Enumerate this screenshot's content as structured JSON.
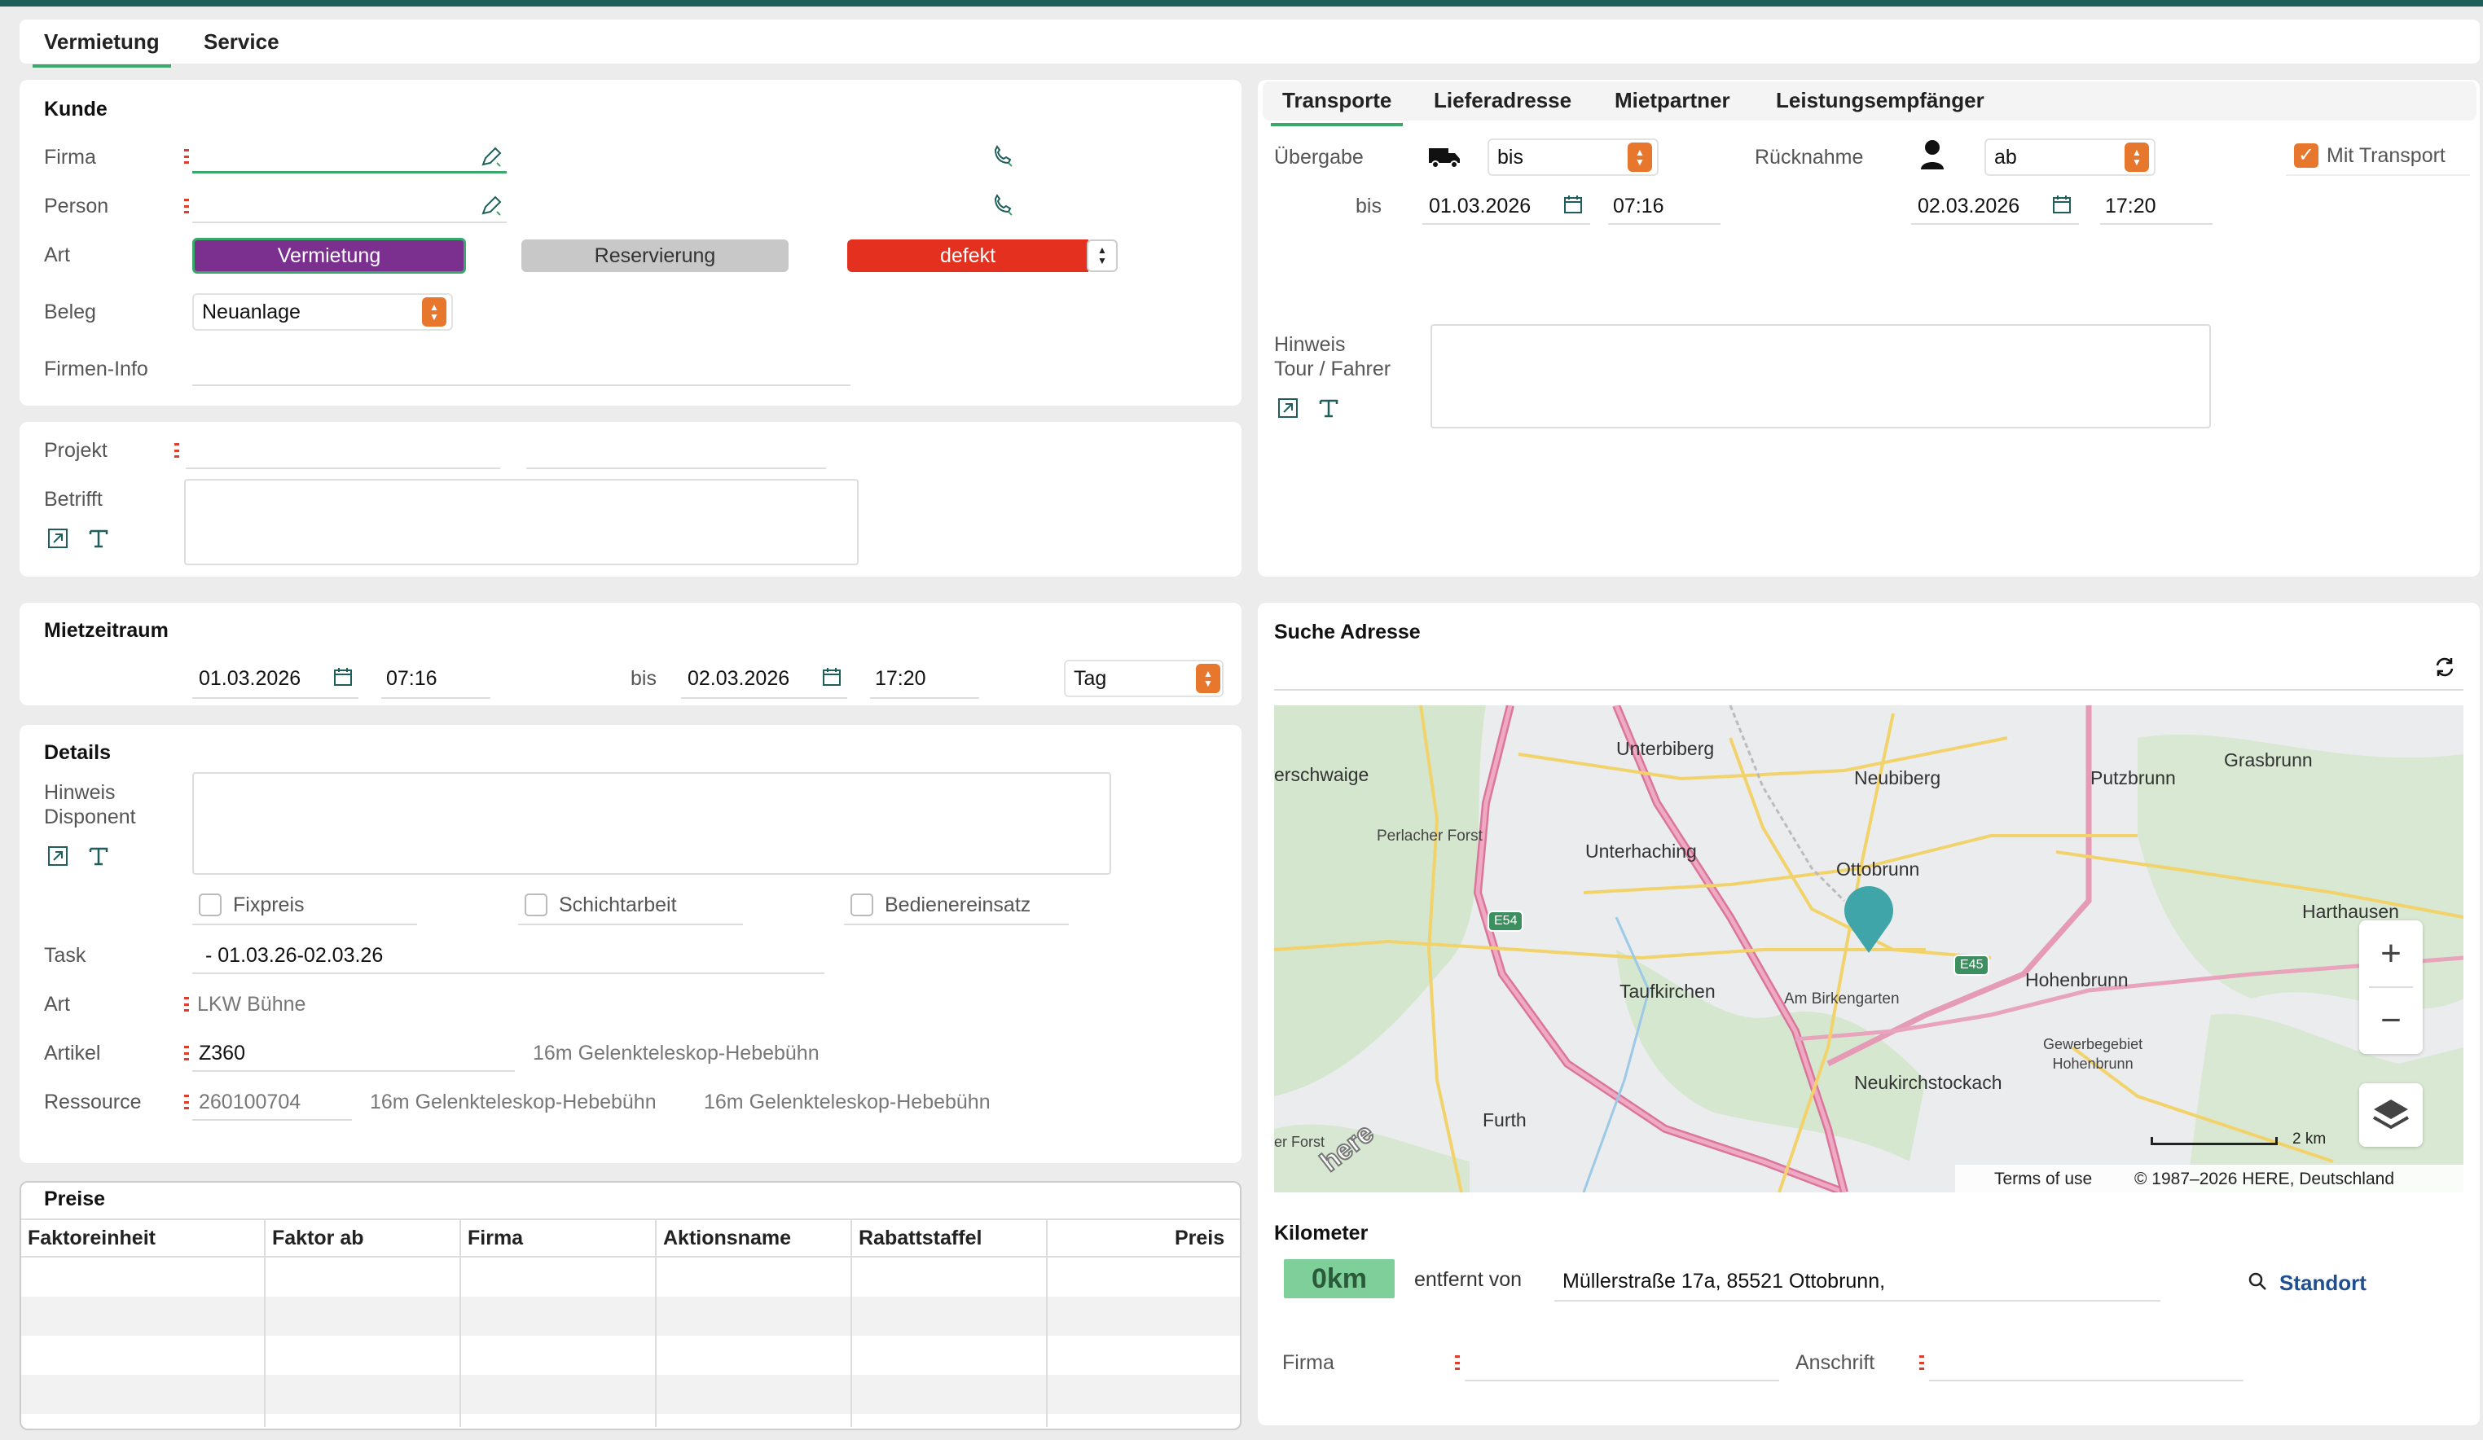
{
  "top_tabs": [
    "Vermietung",
    "Service"
  ],
  "kunde": {
    "title": "Kunde",
    "firma_label": "Firma",
    "person_label": "Person",
    "art_label": "Art",
    "art_buttons": [
      "Vermietung",
      "Reservierung",
      "defekt"
    ],
    "beleg_label": "Beleg",
    "beleg_value": "Neuanlage",
    "firmeninfo_label": "Firmen-Info"
  },
  "projekt": {
    "projekt_label": "Projekt",
    "betrifft_label": "Betrifft"
  },
  "mietzeitraum": {
    "title": "Mietzeitraum",
    "from_date": "01.03.2026",
    "from_time": "07:16",
    "bis_label": "bis",
    "to_date": "02.03.2026",
    "to_time": "17:20",
    "unit": "Tag"
  },
  "details": {
    "title": "Details",
    "hinweis_label": "Hinweis\nDisponent",
    "checkboxes": [
      "Fixpreis",
      "Schichtarbeit",
      "Bedienereinsatz"
    ],
    "task_label": "Task",
    "task_value": "- 01.03.26-02.03.26",
    "art_label": "Art",
    "art_value": "LKW Bühne",
    "artikel_label": "Artikel",
    "artikel_value": "Z360",
    "artikel_desc": "16m Gelenkteleskop-Hebebühn",
    "ressource_label": "Ressource",
    "ressource_value": "260100704",
    "ressource_desc1": "16m Gelenkteleskop-Hebebühn",
    "ressource_desc2": "16m Gelenkteleskop-Hebebühn"
  },
  "preise": {
    "title": "Preise",
    "columns": [
      "Faktoreinheit",
      "Faktor ab",
      "Firma",
      "Aktionsname",
      "Rabattstaffel",
      "Preis"
    ]
  },
  "right_tabs": [
    "Transporte",
    "Lieferadresse",
    "Mietpartner",
    "Leistungsempfänger"
  ],
  "transporte": {
    "uebergabe_label": "Übergabe",
    "uebergabe_mode": "bis",
    "ruecknahme_label": "Rücknahme",
    "ruecknahme_mode": "ab",
    "mit_transport": "Mit Transport",
    "bis_label": "bis",
    "u_date": "01.03.2026",
    "u_time": "07:16",
    "r_date": "02.03.2026",
    "r_time": "17:20",
    "hinweis_label": "Hinweis\nTour / Fahrer"
  },
  "suche": {
    "title": "Suche Adresse",
    "map_labels": [
      "erschwaige",
      "Unterbiberg",
      "Neubiberg",
      "Putzbrunn",
      "Grasbrunn",
      "Perlacher Forst",
      "Unterhaching",
      "Ottobrunn",
      "Harthausen",
      "E54",
      "E45",
      "Taufkirchen",
      "Am Birkengarten",
      "Hohenbrunn",
      "Gewerbegebiet\nHohenbrunn",
      "Neukirchstockach",
      "Furth",
      "er Forst",
      "here"
    ],
    "scale": "2 km",
    "terms": "Terms of use",
    "copyright": "© 1987–2026 HERE, Deutschland"
  },
  "kilometer": {
    "title": "Kilometer",
    "value": "0km",
    "entfernt": "entfernt von",
    "address": "Müllerstraße 17a, 85521 Ottobrunn,",
    "standort": "Standort",
    "firma_label": "Firma",
    "anschrift_label": "Anschrift"
  },
  "colors": {
    "accent_green": "#3aa86b",
    "vermietung_purple": "#7b2f8f",
    "defekt_red": "#e3301f",
    "spinner_orange": "#e8772e",
    "topbar": "#1f5f5b"
  }
}
